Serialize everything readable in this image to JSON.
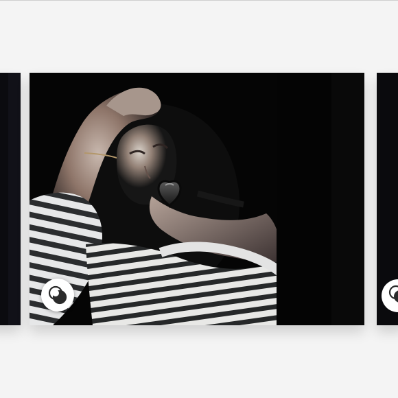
{
  "screen": {
    "title": ""
  },
  "carousel": {
    "slides": [
      {
        "kind": "photo",
        "position": "previous"
      },
      {
        "kind": "photo",
        "position": "current"
      },
      {
        "kind": "photo",
        "position": "next"
      }
    ],
    "badge_icon": "overlap-circles-icon",
    "sticker_icon": "heart-sticker-icon"
  },
  "colors": {
    "background": "#f4f4f4",
    "badge_background": "#ffffff",
    "photo_dark": "#050505"
  }
}
